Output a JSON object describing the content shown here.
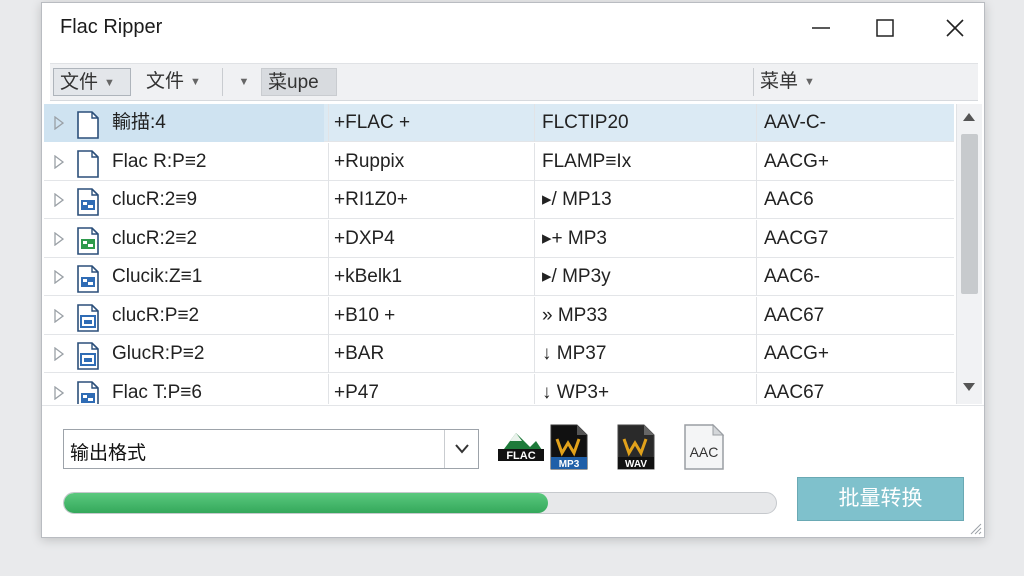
{
  "window": {
    "title": "Flac Ripper"
  },
  "toolbar": {
    "menu1": "文件",
    "menu2": "文件",
    "menu3_tab": "菜upe",
    "menu4": "菜单"
  },
  "rows": [
    {
      "name": "輸描:4",
      "c2": "+FLAC +",
      "c3": "FLCTIP20",
      "c4": "AAV-C-",
      "icon": "blank-file-icon",
      "selected": true
    },
    {
      "name": "Flac R:P≡2",
      "c2": "+Ruppix",
      "c3": "FLAMP≡Ix",
      "c4": "AACG+",
      "icon": "blank-file-icon"
    },
    {
      "name": "clucR:2≡9",
      "c2": "+RI1Z0+",
      "c3": "▸/ MP13",
      "c4": "AAC6",
      "icon": "audio-file-icon"
    },
    {
      "name": "clucR:2≡2",
      "c2": "+DXP4",
      "c3": "▸+ MP3",
      "c4": "AACG7",
      "icon": "audio-file-green-icon"
    },
    {
      "name": "Clucik:Z≡1",
      "c2": "+kBelk1",
      "c3": "▸/ MP3y",
      "c4": "AAC6-",
      "icon": "audio-file-icon"
    },
    {
      "name": "clucR:P≡2",
      "c2": "+B10 +",
      "c3": "» MP33",
      "c4": "AAC67",
      "icon": "image-file-icon"
    },
    {
      "name": "GlucR:P≡2",
      "c2": "+BAR",
      "c3": "↓ MP37",
      "c4": "AACG+",
      "icon": "image-file-icon"
    },
    {
      "name": "Flac T:P≡6",
      "c2": "+P47",
      "c3": "↓ WP3+",
      "c4": "AAC67",
      "icon": "audio-file-icon"
    }
  ],
  "format": {
    "selected": "输出格式"
  },
  "formats": [
    {
      "name": "flac",
      "label": "FLAC"
    },
    {
      "name": "mp3",
      "label": "MP3"
    },
    {
      "name": "wav",
      "label": "WAV"
    },
    {
      "name": "aac",
      "label": "AAC"
    }
  ],
  "progress": {
    "percent": 68
  },
  "convert_button": "批量转换",
  "colors": {
    "selected_row": "#dbeaf4",
    "progress_fill": "#3cb565",
    "convert_button": "#7fc1cc"
  }
}
